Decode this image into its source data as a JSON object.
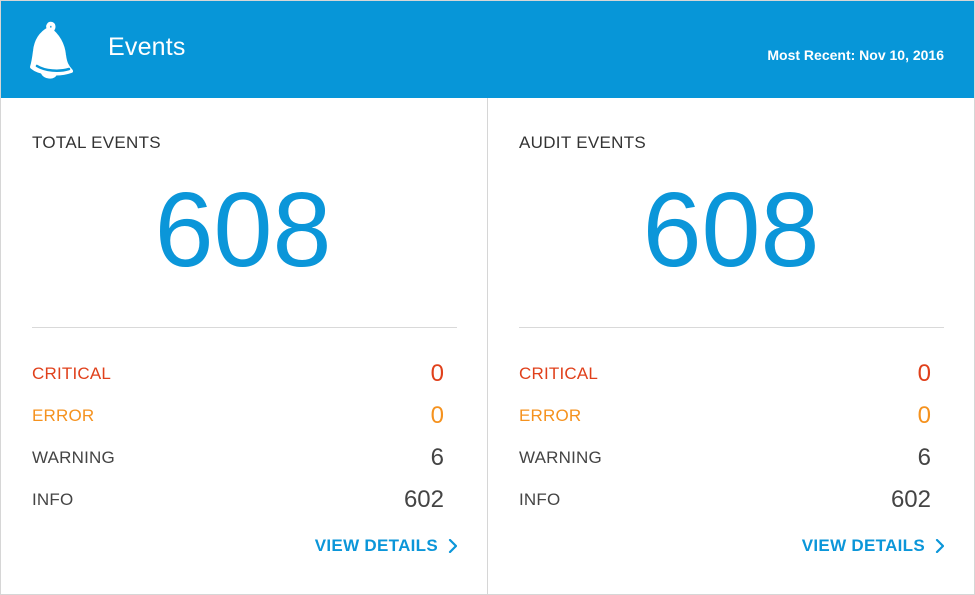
{
  "header": {
    "title": "Events",
    "most_recent": "Most Recent: Nov 10, 2016",
    "icon": "bell-icon",
    "background_color": "#0796d8"
  },
  "panels": [
    {
      "title": "TOTAL EVENTS",
      "count": "608",
      "stats": [
        {
          "label": "CRITICAL",
          "value": "0",
          "color": "#e0401b"
        },
        {
          "label": "ERROR",
          "value": "0",
          "color": "#f5921e"
        },
        {
          "label": "WARNING",
          "value": "6",
          "color": "#444444"
        },
        {
          "label": "INFO",
          "value": "602",
          "color": "#444444"
        }
      ],
      "link_label": "VIEW DETAILS",
      "link_icon": "chevron-right-icon"
    },
    {
      "title": "AUDIT EVENTS",
      "count": "608",
      "stats": [
        {
          "label": "CRITICAL",
          "value": "0",
          "color": "#e0401b"
        },
        {
          "label": "ERROR",
          "value": "0",
          "color": "#f5921e"
        },
        {
          "label": "WARNING",
          "value": "6",
          "color": "#444444"
        },
        {
          "label": "INFO",
          "value": "602",
          "color": "#444444"
        }
      ],
      "link_label": "VIEW DETAILS",
      "link_icon": "chevron-right-icon"
    }
  ],
  "accent_color": "#0b96d9"
}
